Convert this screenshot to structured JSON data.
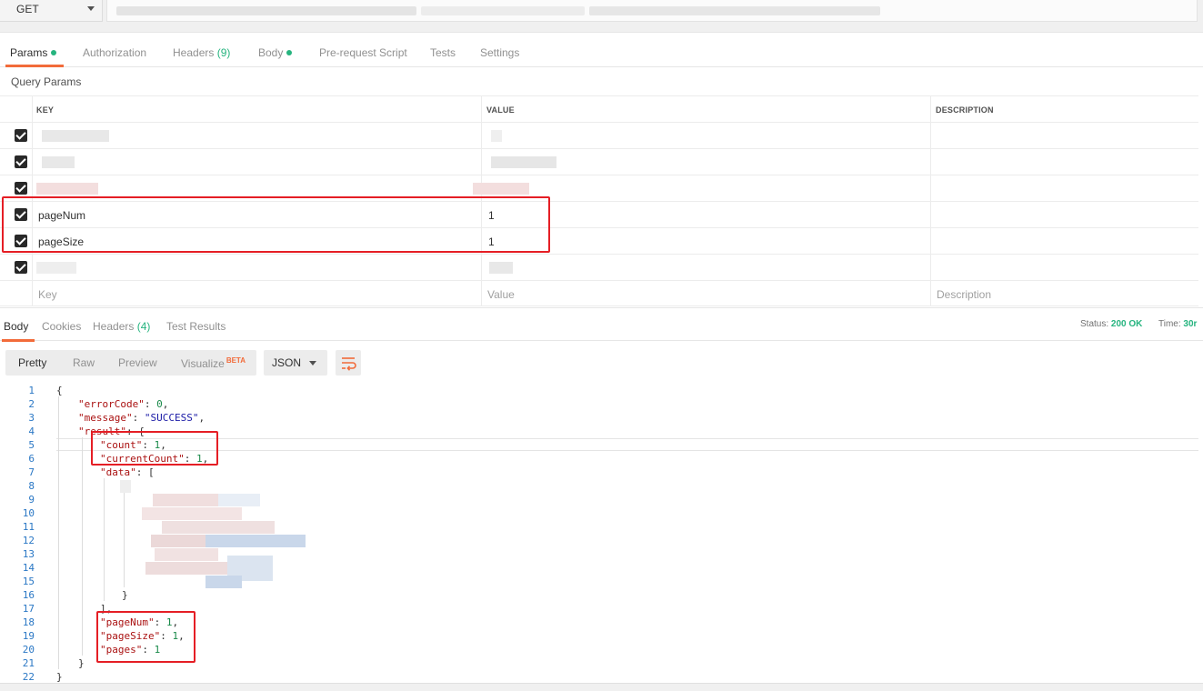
{
  "request": {
    "method": "GET"
  },
  "request_tabs": [
    {
      "label": "Params",
      "dot": true,
      "active": true
    },
    {
      "label": "Authorization"
    },
    {
      "label": "Headers",
      "count": "(9)"
    },
    {
      "label": "Body",
      "dot": true
    },
    {
      "label": "Pre-request Script"
    },
    {
      "label": "Tests"
    },
    {
      "label": "Settings"
    }
  ],
  "query_params": {
    "title": "Query Params",
    "columns": {
      "key": "KEY",
      "value": "VALUE",
      "description": "DESCRIPTION"
    },
    "rows": [
      {
        "key": "",
        "value": "",
        "checked": true
      },
      {
        "key": "",
        "value": "",
        "checked": true
      },
      {
        "key": "",
        "value": "",
        "checked": true
      },
      {
        "key": "pageNum",
        "value": "1",
        "checked": true
      },
      {
        "key": "pageSize",
        "value": "1",
        "checked": true
      },
      {
        "key": "",
        "value": "",
        "checked": true
      }
    ],
    "placeholder": {
      "key": "Key",
      "value": "Value",
      "description": "Description"
    }
  },
  "response_tabs": [
    {
      "label": "Body",
      "active": true
    },
    {
      "label": "Cookies"
    },
    {
      "label": "Headers",
      "count": "(4)"
    },
    {
      "label": "Test Results"
    }
  ],
  "response_status": {
    "status_label": "Status:",
    "status_value": "200 OK",
    "time_label": "Time:",
    "time_value": "30r"
  },
  "viewer": {
    "modes": [
      "Pretty",
      "Raw",
      "Preview",
      "Visualize"
    ],
    "beta": "BETA",
    "format": "JSON",
    "wrap_icon": "wrap-lines-icon"
  },
  "code_lines": [
    {
      "n": "1",
      "text": "{"
    },
    {
      "n": "2",
      "key": "\"errorCode\"",
      "num": "0",
      "trail": ","
    },
    {
      "n": "3",
      "key": "\"message\"",
      "str": "\"SUCCESS\"",
      "trail": ","
    },
    {
      "n": "4",
      "key": "\"result\"",
      "trail": "{"
    },
    {
      "n": "5",
      "key": "\"count\"",
      "num": "1",
      "trail": ","
    },
    {
      "n": "6",
      "key": "\"currentCount\"",
      "num": "1",
      "trail": ","
    },
    {
      "n": "7",
      "key": "\"data\"",
      "trail": "["
    },
    {
      "n": "8"
    },
    {
      "n": "9"
    },
    {
      "n": "10"
    },
    {
      "n": "11"
    },
    {
      "n": "12"
    },
    {
      "n": "13"
    },
    {
      "n": "14"
    },
    {
      "n": "15"
    },
    {
      "n": "16",
      "text": "}"
    },
    {
      "n": "17",
      "text": "],"
    },
    {
      "n": "18",
      "key": "\"pageNum\"",
      "num": "1",
      "trail": ","
    },
    {
      "n": "19",
      "key": "\"pageSize\"",
      "num": "1",
      "trail": ","
    },
    {
      "n": "20",
      "key": "\"pages\"",
      "num": "1"
    },
    {
      "n": "21",
      "text": "}"
    },
    {
      "n": "22",
      "text": "}"
    }
  ],
  "colors": {
    "accent": "#f26b3a",
    "ok_green": "#26b47f",
    "highlight_red": "#e51e25",
    "line_number": "#2b78c5"
  }
}
